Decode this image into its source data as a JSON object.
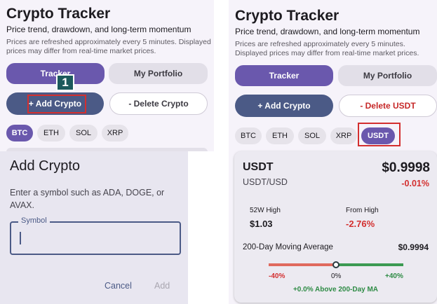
{
  "app": {
    "title": "Crypto Tracker",
    "subtitle": "Price trend, drawdown, and long-term momentum",
    "notice": "Prices are refreshed approximately every 5 minutes. Displayed prices may differ from real-time market prices."
  },
  "tabs": {
    "tracker": "Tracker",
    "portfolio": "My Portfolio"
  },
  "left": {
    "add_label": "+ Add Crypto",
    "delete_label": "- Delete Crypto",
    "chips": [
      "BTC",
      "ETH",
      "SOL",
      "XRP"
    ],
    "step_badge": "1"
  },
  "right": {
    "add_label": "+ Add Crypto",
    "delete_label": "- Delete USDT",
    "chips": [
      "BTC",
      "ETH",
      "SOL",
      "XRP",
      "USDT"
    ]
  },
  "dialog": {
    "title": "Add Crypto",
    "hint": "Enter a symbol such as ADA, DOGE, or AVAX.",
    "field_label": "Symbol",
    "field_value": "",
    "cancel": "Cancel",
    "add": "Add"
  },
  "card": {
    "symbol": "USDT",
    "pair": "USDT/USD",
    "price": "$0.9998",
    "change": "-0.01%",
    "high_label": "52W High",
    "high_value": "$1.03",
    "from_high_label": "From High",
    "from_high_value": "-2.76%",
    "ma_label": "200-Day Moving Average",
    "ma_value": "$0.9994",
    "gauge_min": "-40%",
    "gauge_mid": "0%",
    "gauge_max": "+40%",
    "gauge_position": 0.5,
    "status": "+0.0% Above 200-Day MA"
  },
  "colors": {
    "accent": "#6a58ad",
    "add_button": "#4b5a86",
    "negative": "#d32f2f",
    "positive": "#2e8b45",
    "highlight": "#d32f2f"
  }
}
